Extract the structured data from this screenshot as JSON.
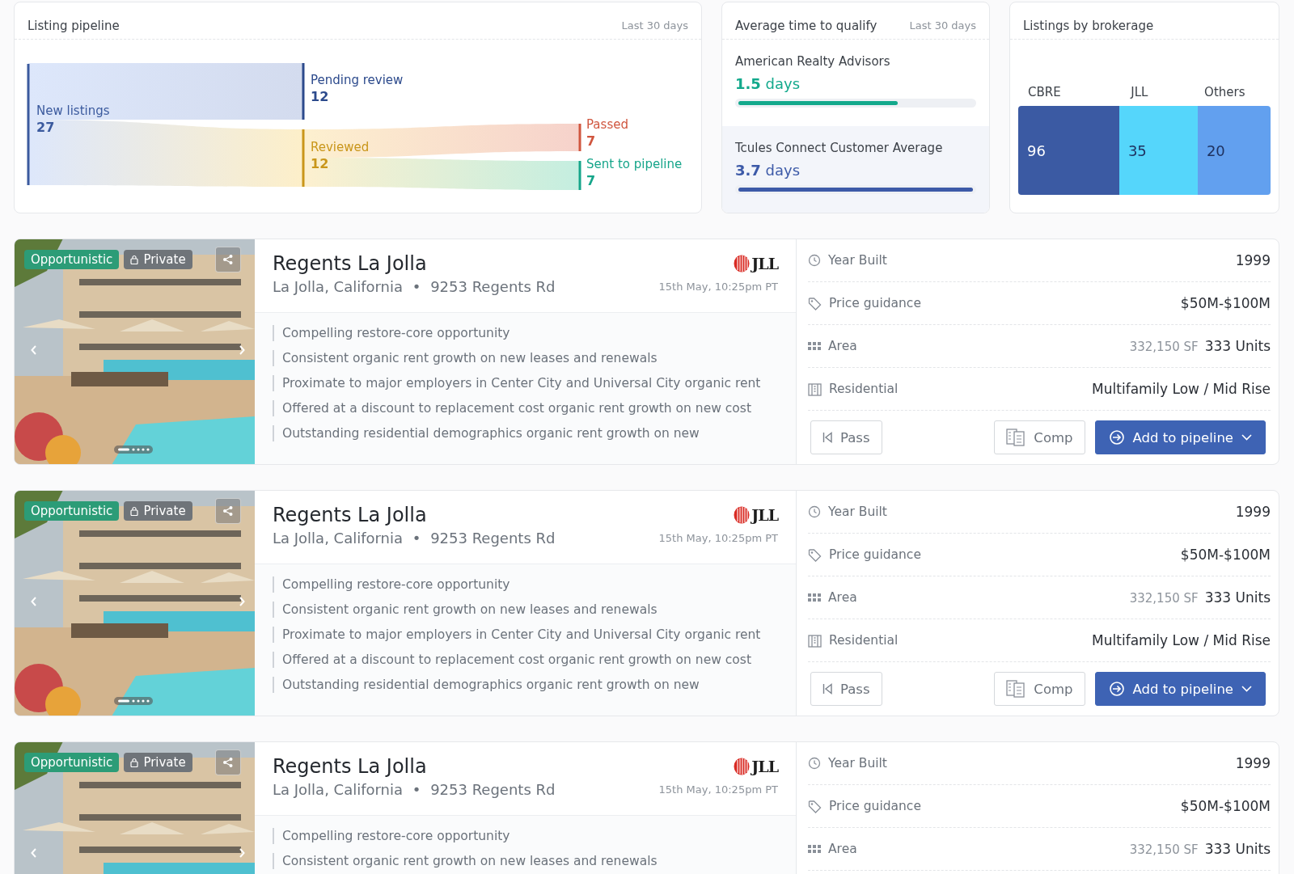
{
  "pipeline": {
    "title": "Listing pipeline",
    "period": "Last 30 days",
    "nodes": [
      {
        "label": "New listings",
        "value": "27",
        "color": "#3b5a9e"
      },
      {
        "label": "Pending review",
        "value": "12",
        "color": "#2c4a8c"
      },
      {
        "label": "Reviewed",
        "value": "12",
        "color": "#c9961a"
      },
      {
        "label": "Passed",
        "value": "7",
        "color": "#d0563f"
      },
      {
        "label": "Sent to pipeline",
        "value": "7",
        "color": "#16a58a"
      }
    ]
  },
  "qualify": {
    "title": "Average time to qualify",
    "period": "Last 30 days",
    "items": [
      {
        "name": "American Realty Advisors",
        "number": "1.5",
        "unit": "days",
        "level": 0.68,
        "color": "#13a98c",
        "selected": false
      },
      {
        "name": "Tcules Connect Customer Average",
        "number": "3.7",
        "unit": "days",
        "level": 1,
        "color": "#3d5aa8",
        "selected": true
      }
    ]
  },
  "brokerage": {
    "title": "Listings by brokerage",
    "segments": [
      {
        "label": "CBRE",
        "value": "96",
        "color": "#3b5aa3"
      },
      {
        "label": "JLL",
        "value": "35",
        "color": "#55d6fb"
      },
      {
        "label": "Others",
        "value": "20",
        "color": "#62a0ef"
      }
    ]
  },
  "listings": [
    {
      "tags": [
        {
          "label": "Opportunistic",
          "kind": "strategy"
        },
        {
          "label": "Private",
          "kind": "private"
        }
      ],
      "title": "Regents La Jolla",
      "location": "La Jolla, California",
      "separator": "•",
      "address": "9253 Regents Rd",
      "broker": "JLL",
      "date": "15th May, 10:25pm PT",
      "bullets": [
        "Compelling restore-core opportunity",
        "Consistent organic rent growth on new leases and renewals",
        "Proximate to major employers in Center City and Universal City organic rent",
        "Offered at a discount to replacement cost organic rent growth on new cost",
        "Outstanding residential demographics organic rent growth on new"
      ],
      "specs": [
        {
          "kind": "year",
          "label": "Year Built",
          "value": "1999"
        },
        {
          "kind": "price",
          "label": "Price guidance",
          "value": "$50M-$100M"
        },
        {
          "kind": "area",
          "label": "Area",
          "secondary": "332,150 SF",
          "value": "333 Units"
        },
        {
          "kind": "type",
          "label": "Residential",
          "value": "Multifamily Low / Mid Rise"
        }
      ],
      "actions": {
        "pass": "Pass",
        "comp": "Comp",
        "add": "Add to pipeline"
      }
    },
    {
      "tags": [
        {
          "label": "Opportunistic",
          "kind": "strategy"
        },
        {
          "label": "Private",
          "kind": "private"
        }
      ],
      "title": "Regents La Jolla",
      "location": "La Jolla, California",
      "separator": "•",
      "address": "9253 Regents Rd",
      "broker": "JLL",
      "date": "15th May, 10:25pm PT",
      "bullets": [
        "Compelling restore-core opportunity",
        "Consistent organic rent growth on new leases and renewals",
        "Proximate to major employers in Center City and Universal City organic rent",
        "Offered at a discount to replacement cost organic rent growth on new cost",
        "Outstanding residential demographics organic rent growth on new"
      ],
      "specs": [
        {
          "kind": "year",
          "label": "Year Built",
          "value": "1999"
        },
        {
          "kind": "price",
          "label": "Price guidance",
          "value": "$50M-$100M"
        },
        {
          "kind": "area",
          "label": "Area",
          "secondary": "332,150 SF",
          "value": "333 Units"
        },
        {
          "kind": "type",
          "label": "Residential",
          "value": "Multifamily Low / Mid Rise"
        }
      ],
      "actions": {
        "pass": "Pass",
        "comp": "Comp",
        "add": "Add to pipeline"
      }
    },
    {
      "tags": [
        {
          "label": "Opportunistic",
          "kind": "strategy"
        },
        {
          "label": "Private",
          "kind": "private"
        }
      ],
      "title": "Regents La Jolla",
      "location": "La Jolla, California",
      "separator": "•",
      "address": "9253 Regents Rd",
      "broker": "JLL",
      "date": "15th May, 10:25pm PT",
      "bullets": [
        "Compelling restore-core opportunity",
        "Consistent organic rent growth on new leases and renewals"
      ],
      "specs": [
        {
          "kind": "year",
          "label": "Year Built",
          "value": "1999"
        },
        {
          "kind": "price",
          "label": "Price guidance",
          "value": "$50M-$100M"
        },
        {
          "kind": "area",
          "label": "Area",
          "secondary": "332,150 SF",
          "value": "333 Units"
        }
      ]
    }
  ]
}
